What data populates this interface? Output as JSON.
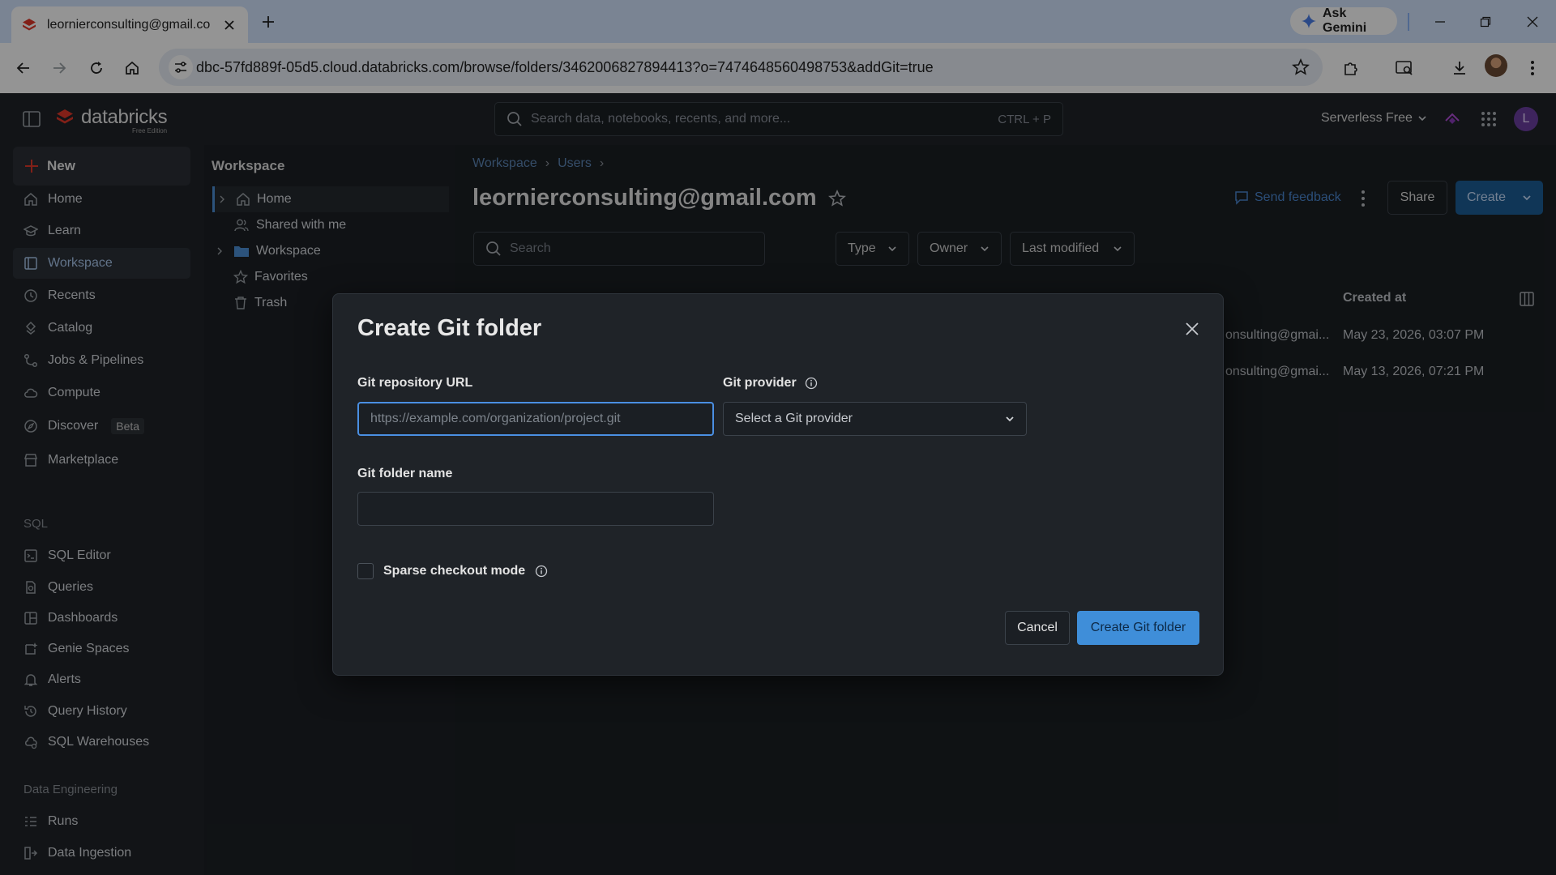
{
  "browser": {
    "tab_title": "leornierconsulting@gmail.com",
    "url": "dbc-57fd889f-05d5.cloud.databricks.com/browse/folders/3462006827894413?o=7474648560498753&addGit=true",
    "gemini_label": "Ask Gemini"
  },
  "topnav": {
    "brand": "databricks",
    "edition": "Free Edition",
    "search_placeholder": "Search data, notebooks, recents, and more...",
    "search_shortcut": "CTRL + P",
    "compute": "Serverless Free",
    "user_initial": "L"
  },
  "sidebar": {
    "new_label": "New",
    "items": [
      {
        "label": "Home",
        "icon": "home-icon"
      },
      {
        "label": "Learn",
        "icon": "learn-icon"
      },
      {
        "label": "Workspace",
        "icon": "workspace-icon"
      },
      {
        "label": "Recents",
        "icon": "clock-icon"
      },
      {
        "label": "Catalog",
        "icon": "catalog-icon"
      },
      {
        "label": "Jobs & Pipelines",
        "icon": "jobs-icon"
      },
      {
        "label": "Compute",
        "icon": "cloud-icon"
      },
      {
        "label": "Discover",
        "icon": "compass-icon",
        "badge": "Beta"
      },
      {
        "label": "Marketplace",
        "icon": "store-icon"
      }
    ],
    "sql_section": "SQL",
    "sql_items": [
      {
        "label": "SQL Editor"
      },
      {
        "label": "Queries"
      },
      {
        "label": "Dashboards"
      },
      {
        "label": "Genie Spaces"
      },
      {
        "label": "Alerts"
      },
      {
        "label": "Query History"
      },
      {
        "label": "SQL Warehouses"
      }
    ],
    "de_section": "Data Engineering",
    "de_items": [
      {
        "label": "Runs"
      },
      {
        "label": "Data Ingestion"
      }
    ]
  },
  "tree": {
    "title": "Workspace",
    "items": [
      {
        "label": "Home"
      },
      {
        "label": "Shared with me"
      },
      {
        "label": "Workspace"
      },
      {
        "label": "Favorites"
      },
      {
        "label": "Trash"
      }
    ]
  },
  "main": {
    "breadcrumb": [
      "Workspace",
      "Users"
    ],
    "title": "leornierconsulting@gmail.com",
    "send_feedback": "Send feedback",
    "share": "Share",
    "create": "Create",
    "search_placeholder": "Search",
    "filters": [
      "Type",
      "Owner",
      "Last modified"
    ],
    "created_at_header": "Created at",
    "rows": [
      {
        "owner": "onsulting@gmai...",
        "created": "May 23, 2026, 03:07 PM"
      },
      {
        "owner": "onsulting@gmai...",
        "created": "May 13, 2026, 07:21 PM"
      }
    ]
  },
  "dialog": {
    "title": "Create Git folder",
    "repo_url_label": "Git repository URL",
    "repo_url_placeholder": "https://example.com/organization/project.git",
    "provider_label": "Git provider",
    "provider_placeholder": "Select a Git provider",
    "folder_name_label": "Git folder name",
    "sparse_label": "Sparse checkout mode",
    "cancel": "Cancel",
    "submit": "Create Git folder"
  },
  "colors": {
    "accent": "#3f8ed9",
    "brand_red": "#e0382a",
    "active_nav": "#a9c7ec"
  }
}
